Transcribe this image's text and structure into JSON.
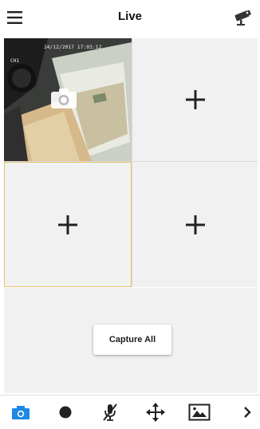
{
  "header": {
    "title": "Live",
    "menu_icon": "hamburger-menu-icon",
    "camera_icon": "cctv-camera-icon"
  },
  "grid": {
    "channels": [
      {
        "state": "live",
        "timestamp": "24/12/2017 17:03:12",
        "channel_label": "CH1",
        "overlay_icon": "camera-snapshot-icon"
      },
      {
        "state": "empty",
        "icon": "plus-icon"
      },
      {
        "state": "empty",
        "icon": "plus-icon",
        "selected": true
      },
      {
        "state": "empty",
        "icon": "plus-icon"
      }
    ],
    "selected_border_color": "#e6c368"
  },
  "capture_all_label": "Capture All",
  "toolbar": {
    "items": [
      {
        "name": "snapshot",
        "icon": "camera-icon",
        "active": true
      },
      {
        "name": "record",
        "icon": "record-dot-icon"
      },
      {
        "name": "microphone",
        "icon": "microphone-muted-icon"
      },
      {
        "name": "ptz",
        "icon": "move-arrows-icon"
      },
      {
        "name": "gallery",
        "icon": "image-gallery-icon"
      },
      {
        "name": "next",
        "icon": "chevron-right-icon"
      }
    ]
  },
  "colors": {
    "accent": "#1e88e5",
    "icon": "#222222",
    "empty_tile": "#f1f1f1"
  }
}
